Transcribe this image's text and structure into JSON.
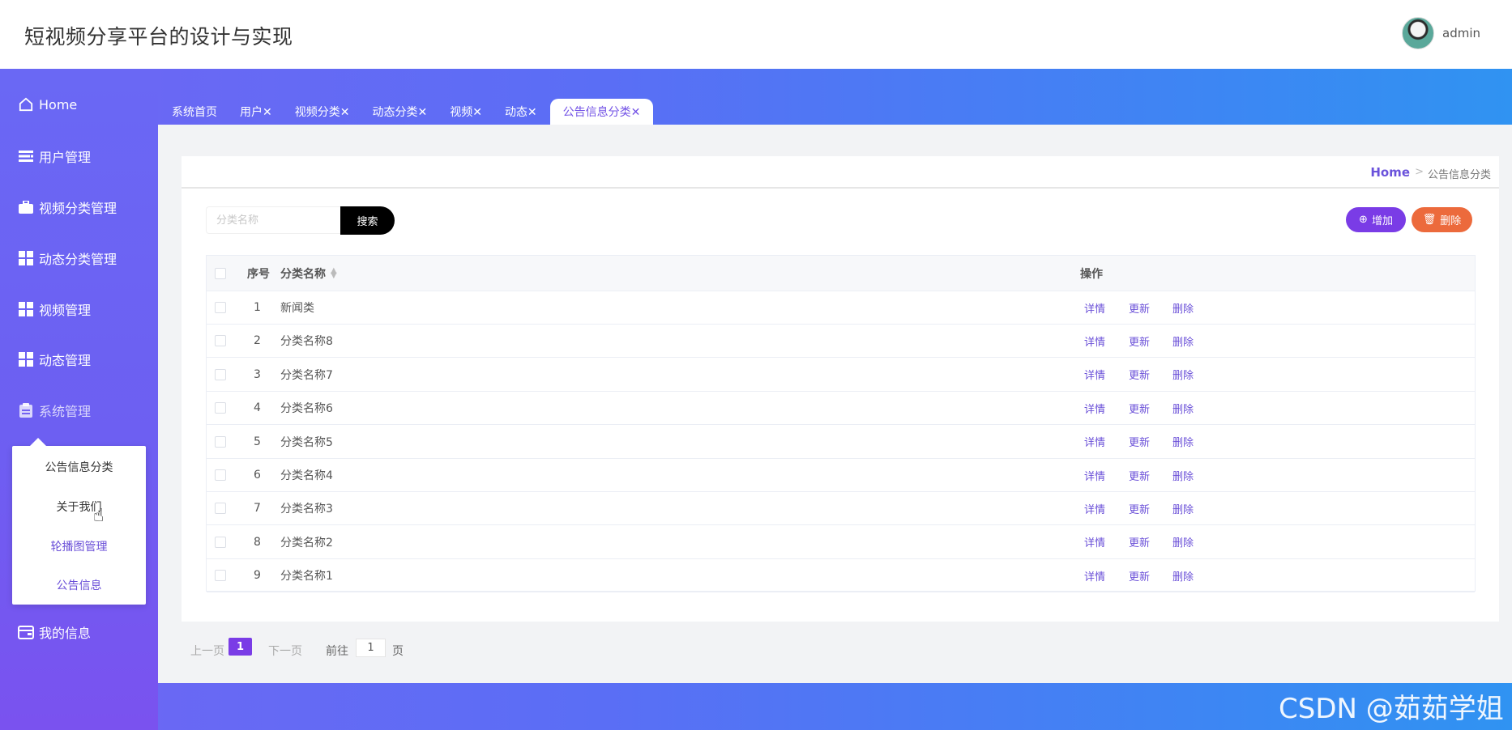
{
  "header": {
    "title": "短视频分享平台的设计与实现",
    "username": "admin"
  },
  "sidebar": {
    "items": [
      {
        "label": "Home",
        "icon": "home-icon"
      },
      {
        "label": "用户管理",
        "icon": "list-icon"
      },
      {
        "label": "视频分类管理",
        "icon": "briefcase-icon"
      },
      {
        "label": "动态分类管理",
        "icon": "grid-icon"
      },
      {
        "label": "视频管理",
        "icon": "grid-icon"
      },
      {
        "label": "动态管理",
        "icon": "grid-icon"
      },
      {
        "label": "系统管理",
        "icon": "clipboard-icon"
      },
      {
        "label": "我的信息",
        "icon": "wallet-icon"
      }
    ],
    "submenu": [
      "公告信息分类",
      "关于我们",
      "轮播图管理",
      "公告信息"
    ]
  },
  "tabs": [
    "系统首页",
    "用户✕",
    "视频分类✕",
    "动态分类✕",
    "视频✕",
    "动态✕",
    "公告信息分类✕"
  ],
  "breadcrumb": {
    "home": "Home",
    "sep": ">",
    "current": "公告信息分类"
  },
  "search": {
    "placeholder": "分类名称",
    "button": "搜索"
  },
  "actions": {
    "add": "增加",
    "delete": "删除"
  },
  "table": {
    "headers": {
      "index": "序号",
      "name": "分类名称",
      "ops": "操作"
    },
    "rows": [
      {
        "index": "1",
        "name": "新闻类"
      },
      {
        "index": "2",
        "name": "分类名称8"
      },
      {
        "index": "3",
        "name": "分类名称7"
      },
      {
        "index": "4",
        "name": "分类名称6"
      },
      {
        "index": "5",
        "name": "分类名称5"
      },
      {
        "index": "6",
        "name": "分类名称4"
      },
      {
        "index": "7",
        "name": "分类名称3"
      },
      {
        "index": "8",
        "name": "分类名称2"
      },
      {
        "index": "9",
        "name": "分类名称1"
      }
    ],
    "row_actions": {
      "detail": "详情",
      "update": "更新",
      "delete": "删除"
    }
  },
  "pagination": {
    "prev": "上一页",
    "current": "1",
    "next": "下一页",
    "goto": "前往",
    "input": "1",
    "page": "页"
  },
  "watermark": "CSDN @茹茹学姐",
  "colors": {
    "accent": "#7a3ce6",
    "danger": "#ec6a3c",
    "link": "#6a4fd8"
  }
}
